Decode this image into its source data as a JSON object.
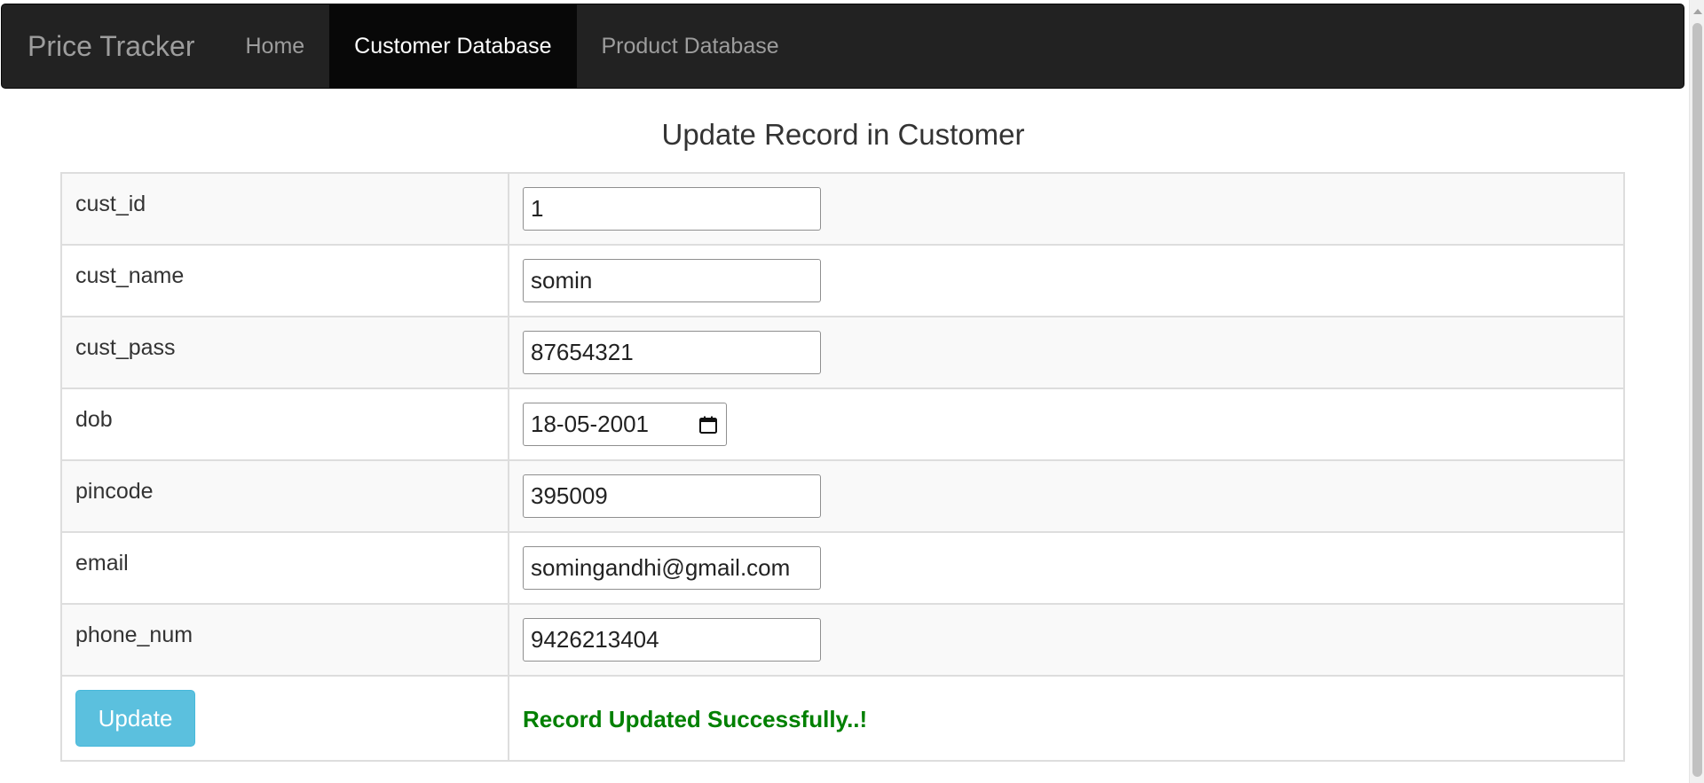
{
  "navbar": {
    "brand": "Price Tracker",
    "items": [
      {
        "label": "Home",
        "active": false
      },
      {
        "label": "Customer Database",
        "active": true
      },
      {
        "label": "Product Database",
        "active": false
      }
    ]
  },
  "page": {
    "heading": "Update Record in Customer"
  },
  "form": {
    "fields": [
      {
        "label": "cust_id",
        "value": "1"
      },
      {
        "label": "cust_name",
        "value": "somin"
      },
      {
        "label": "cust_pass",
        "value": "87654321"
      },
      {
        "label": "dob",
        "value": "18-05-2001"
      },
      {
        "label": "pincode",
        "value": "395009"
      },
      {
        "label": "email",
        "value": "somingandhi@gmail.com"
      },
      {
        "label": "phone_num",
        "value": "9426213404"
      }
    ],
    "submit_label": "Update",
    "status_message": "Record Updated Successfully..!"
  },
  "colors": {
    "navbar_bg": "#222222",
    "button_bg": "#5bc0de",
    "success_text": "#008000"
  },
  "icons": {
    "date_picker": "calendar-icon"
  }
}
